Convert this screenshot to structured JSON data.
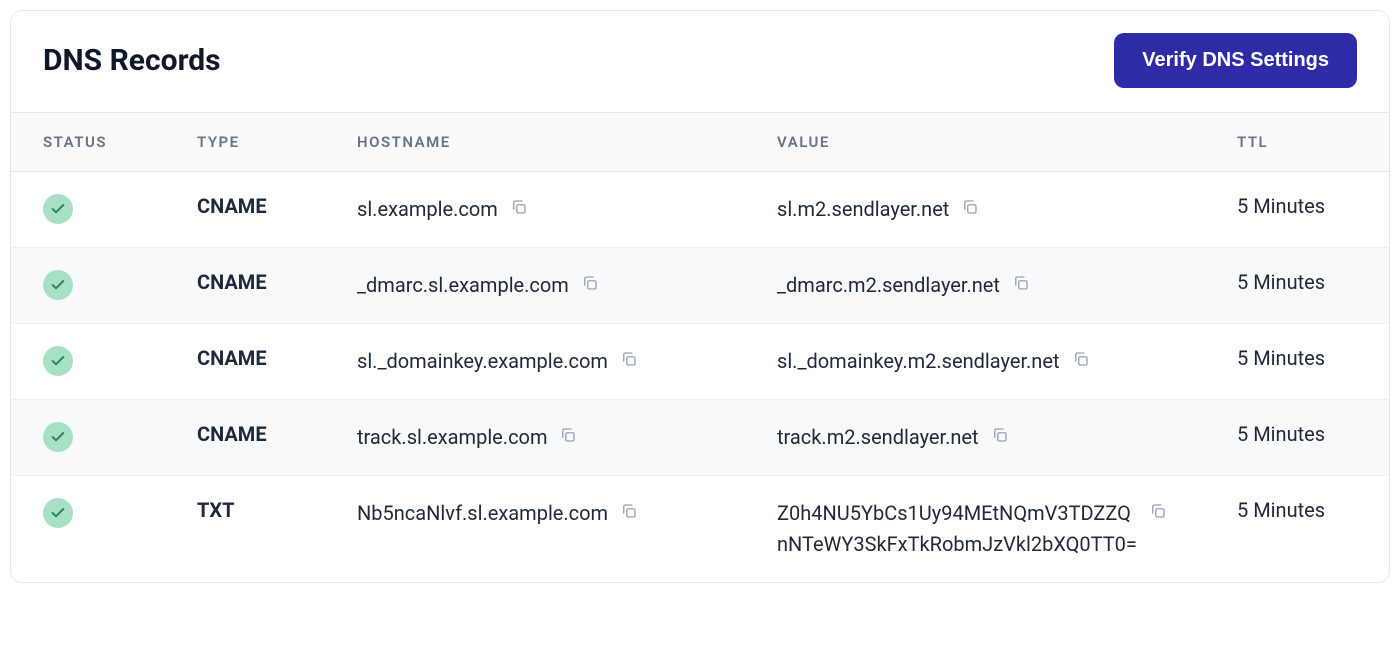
{
  "header": {
    "title": "DNS Records",
    "verify_button": "Verify DNS Settings"
  },
  "columns": {
    "status": "STATUS",
    "type": "TYPE",
    "hostname": "HOSTNAME",
    "value": "VALUE",
    "ttl": "TTL"
  },
  "status_colors": {
    "ok_bg": "#a7e1c4",
    "ok_check": "#2f855a"
  },
  "records": [
    {
      "status": "ok",
      "type": "CNAME",
      "hostname": "sl.example.com",
      "value": "sl.m2.sendlayer.net",
      "ttl": "5 Minutes"
    },
    {
      "status": "ok",
      "type": "CNAME",
      "hostname": "_dmarc.sl.example.com",
      "value": "_dmarc.m2.sendlayer.net",
      "ttl": "5 Minutes"
    },
    {
      "status": "ok",
      "type": "CNAME",
      "hostname": "sl._domainkey.example.com",
      "value": "sl._domainkey.m2.sendlayer.net",
      "ttl": "5 Minutes"
    },
    {
      "status": "ok",
      "type": "CNAME",
      "hostname": "track.sl.example.com",
      "value": "track.m2.sendlayer.net",
      "ttl": "5 Minutes"
    },
    {
      "status": "ok",
      "type": "TXT",
      "hostname": "Nb5ncaNlvf.sl.example.com",
      "value": "Z0h4NU5YbCs1Uy94MEtNQmV3TDZZQnNTeWY3SkFxTkRobmJzVkl2bXQ0TT0=",
      "ttl": "5 Minutes"
    }
  ]
}
